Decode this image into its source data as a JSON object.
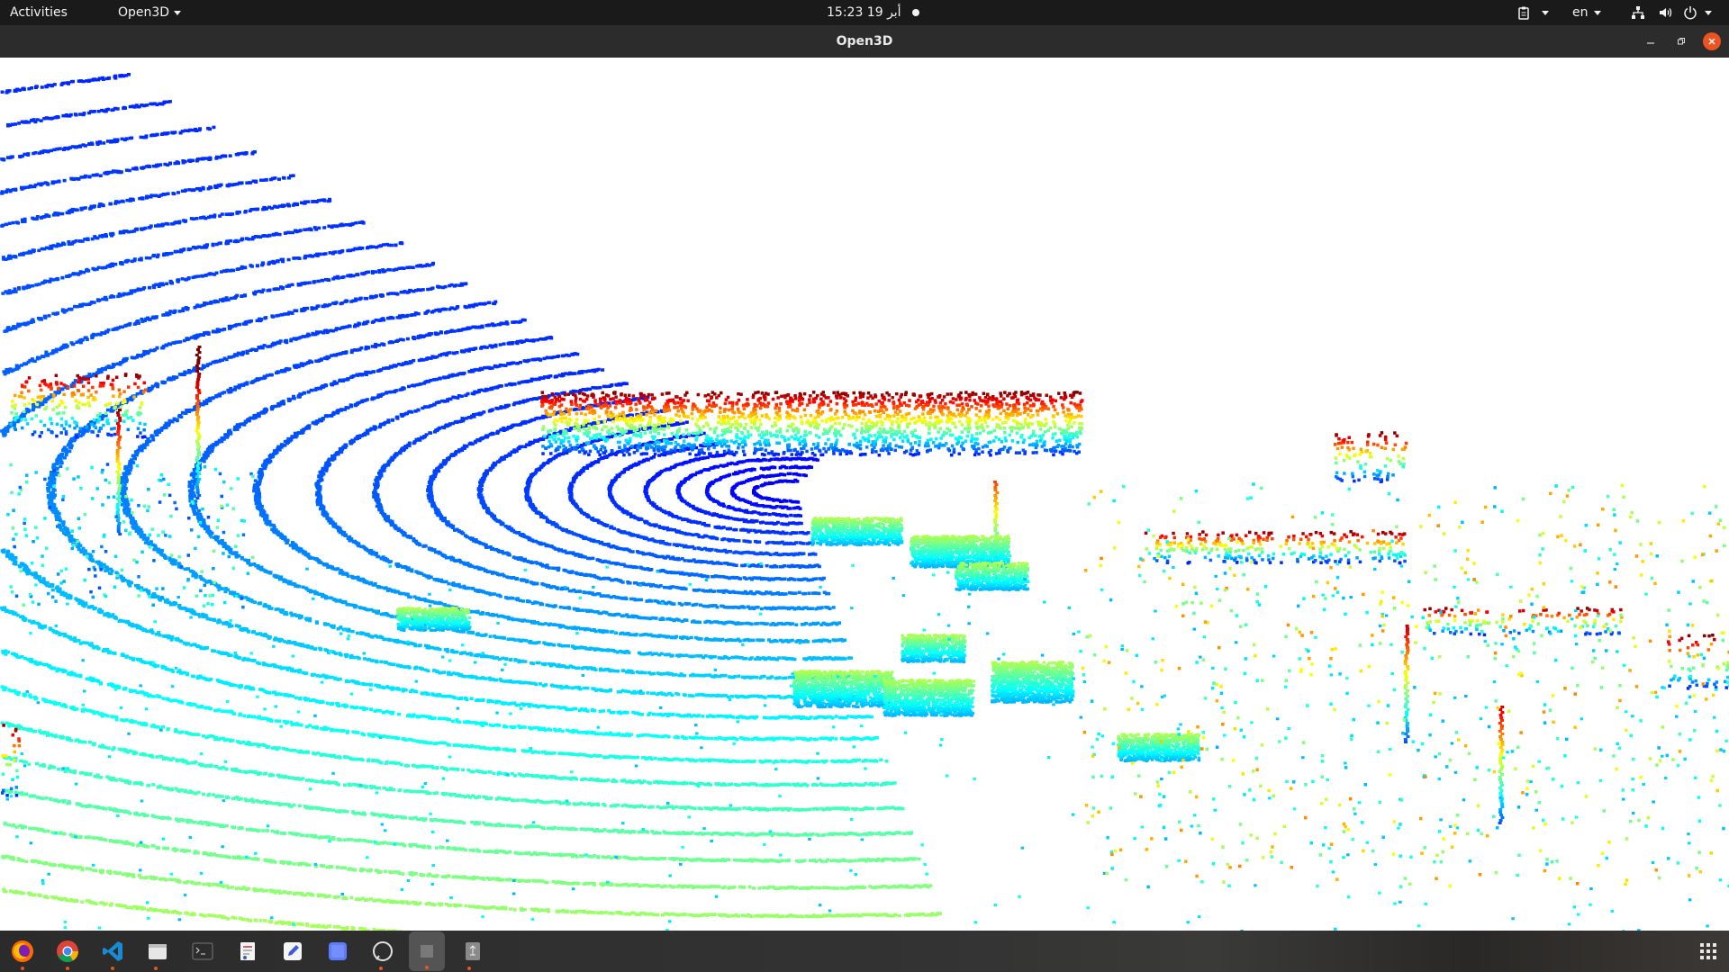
{
  "topbar": {
    "activities": "Activities",
    "app_menu": "Open3D",
    "clock": "15:23  19 أبر",
    "language": "en"
  },
  "window": {
    "title": "Open3D"
  },
  "dock": {
    "apps": [
      "firefox-icon",
      "chrome-icon",
      "vscode-icon",
      "files-icon",
      "terminal-icon",
      "gedit-icon",
      "text-editor-icon",
      "screenshot-icon",
      "chat-icon",
      "open3d-icon",
      "usb-drive-icon"
    ]
  },
  "colors": {
    "topbar": "#1a1a1a",
    "titlebar": "#2c2c2c",
    "close_button": "#e95420",
    "point_near": "#00c4ff",
    "point_far": "#0000ff",
    "point_high": "#ff2000"
  }
}
